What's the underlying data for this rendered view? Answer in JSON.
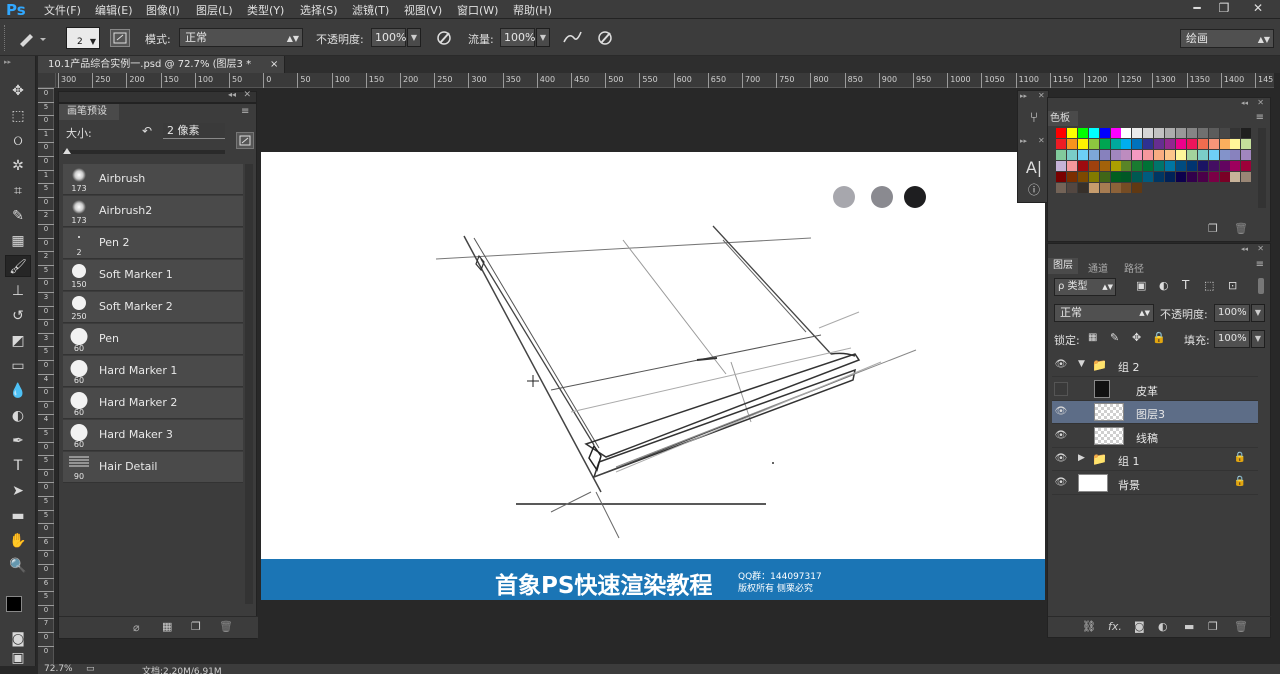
{
  "app": {
    "logo": "Ps"
  },
  "menu": [
    "文件(F)",
    "编辑(E)",
    "图像(I)",
    "图层(L)",
    "类型(Y)",
    "选择(S)",
    "滤镜(T)",
    "视图(V)",
    "窗口(W)",
    "帮助(H)"
  ],
  "window_buttons": {
    "minimize": "━",
    "restore": "❐",
    "close": "✕"
  },
  "options": {
    "brush_size": "2",
    "mode_label": "模式:",
    "mode_value": "正常",
    "opacity_label": "不透明度:",
    "opacity_value": "100%",
    "flow_label": "流量:",
    "flow_value": "100%",
    "workspace": "绘画"
  },
  "document": {
    "tab_title": "10.1产品综合实例一.psd @ 72.7% (图层3 *",
    "tab_close": "×"
  },
  "ruler_h": [
    "300",
    "250",
    "200",
    "150",
    "100",
    "50",
    "0",
    "50",
    "100",
    "150",
    "200",
    "250",
    "300",
    "350",
    "400",
    "450",
    "500",
    "550",
    "600",
    "650",
    "700",
    "750",
    "800",
    "850",
    "900",
    "950",
    "1000",
    "1050",
    "1100",
    "1150",
    "1200",
    "1250",
    "1300",
    "1350",
    "1400",
    "145"
  ],
  "ruler_v": [
    "0",
    "5",
    "0",
    "1",
    "0",
    "0",
    "1",
    "5",
    "0",
    "2",
    "0",
    "0",
    "2",
    "5",
    "0",
    "3",
    "0",
    "0",
    "3",
    "5",
    "0",
    "4",
    "0",
    "0",
    "4",
    "5",
    "0",
    "5",
    "0",
    "0",
    "5",
    "5",
    "0",
    "6",
    "0",
    "0",
    "6",
    "5",
    "0",
    "7",
    "0",
    "0"
  ],
  "brush_panel": {
    "title": "画笔预设",
    "size_label": "大小:",
    "size_value": "2 像素",
    "brushes": [
      {
        "name": "Airbrush",
        "size": "173"
      },
      {
        "name": "Airbrush2",
        "size": "173"
      },
      {
        "name": "Pen 2",
        "size": "2"
      },
      {
        "name": "Soft Marker 1",
        "size": "150"
      },
      {
        "name": "Soft Marker 2",
        "size": "250"
      },
      {
        "name": "Pen",
        "size": "60"
      },
      {
        "name": "Hard Marker 1",
        "size": "60"
      },
      {
        "name": "Hard Marker 2",
        "size": "60"
      },
      {
        "name": "Hard Maker 3",
        "size": "60"
      },
      {
        "name": "Hair Detail",
        "size": "90"
      }
    ]
  },
  "canvas": {
    "banner_title": "首象PS快速渲染教程",
    "banner_qq": "QQ群：144097317",
    "banner_rights": "版权所有  侧栗必究"
  },
  "swatches_panel": {
    "title": "色板"
  },
  "layers_panel": {
    "tabs": [
      "图层",
      "通道",
      "路径"
    ],
    "filter_label": "ρ 类型",
    "blend_mode": "正常",
    "opacity_label": "不透明度:",
    "opacity_value": "100%",
    "lock_label": "锁定:",
    "fill_label": "填充:",
    "fill_value": "100%",
    "layers": [
      {
        "name": "组 2",
        "kind": "group-open"
      },
      {
        "name": "皮革",
        "kind": "layer"
      },
      {
        "name": "图层3",
        "kind": "layer-selected"
      },
      {
        "name": "线稿",
        "kind": "layer"
      },
      {
        "name": "组 1",
        "kind": "group-closed"
      },
      {
        "name": "背景",
        "kind": "background"
      }
    ]
  },
  "status": {
    "zoom": "72.7%",
    "doc": "文档:2.20M/6.91M"
  }
}
